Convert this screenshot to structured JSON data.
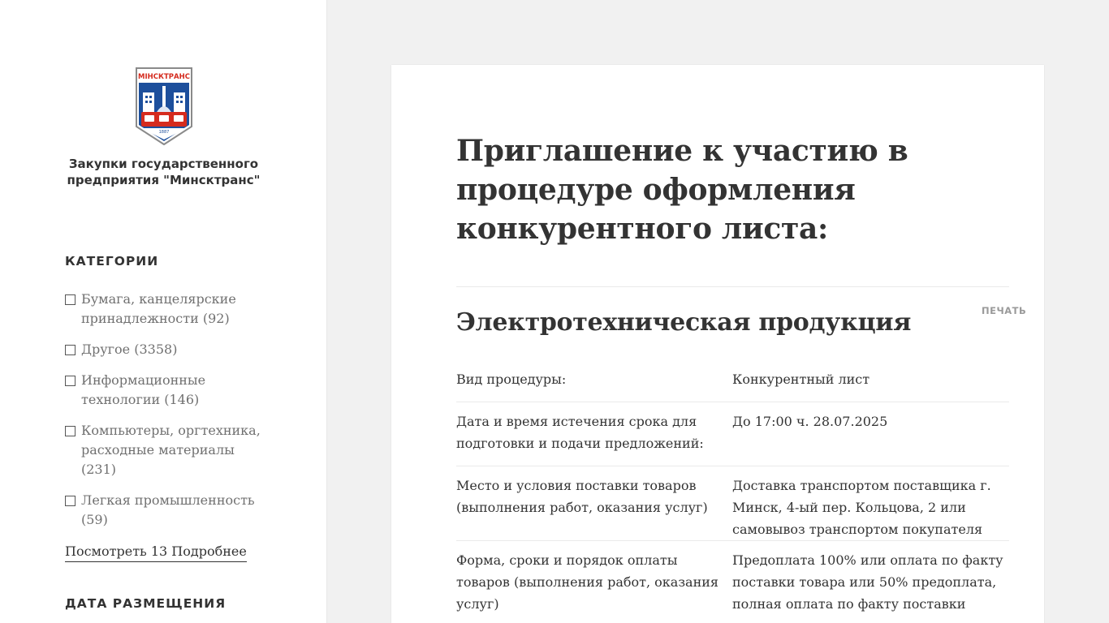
{
  "sidebar": {
    "logo_text": "МІНСКТРАНС",
    "logo_year": "1887",
    "site_title": "Закупки государственного предприятия \"Минсктранс\"",
    "categories_title": "КАТЕГОРИИ",
    "categories": [
      {
        "label": "Бумага, канцелярские принадлежности (92)"
      },
      {
        "label": "Другое (3358)"
      },
      {
        "label": "Информационные технологии (146)"
      },
      {
        "label": "Компьютеры, оргтехника, расходные материалы (231)"
      },
      {
        "label": "Легкая промышленность (59)"
      }
    ],
    "more_link": "Посмотреть 13 Подробнее",
    "date_title": "ДАТА РАЗМЕЩЕНИЯ"
  },
  "main": {
    "page_title": "Приглашение к участию в процедуре оформления конкурентного листа:",
    "print_label": "ПЕЧАТЬ",
    "product_title": "Электротехническая продукция",
    "details": [
      {
        "label": "Вид процедуры:",
        "value": "Конкурентный лист"
      },
      {
        "label": "Дата и время истечения срока для подготовки и подачи предложений:",
        "value": "До 17:00 ч. 28.07.2025"
      },
      {
        "label": "Место и условия поставки товаров (выполнения работ, оказания услуг)",
        "value": "Доставка транспортом поставщика г. Минск, 4-ый пер. Кольцова, 2 или самовывоз транспортом покупателя"
      },
      {
        "label": "Форма, сроки и порядок оплаты товаров (выполнения работ, оказания услуг)",
        "value": "Предоплата 100% или оплата по факту поставки товара или 50% предоплата, полная оплата по факту поставки товара."
      }
    ]
  },
  "colors": {
    "page_bg": "#f1f1f1",
    "card_bg": "#ffffff",
    "text": "#333333",
    "muted_text": "#707070",
    "logo_red": "#d52b1e",
    "logo_blue": "#1d4f9c"
  }
}
